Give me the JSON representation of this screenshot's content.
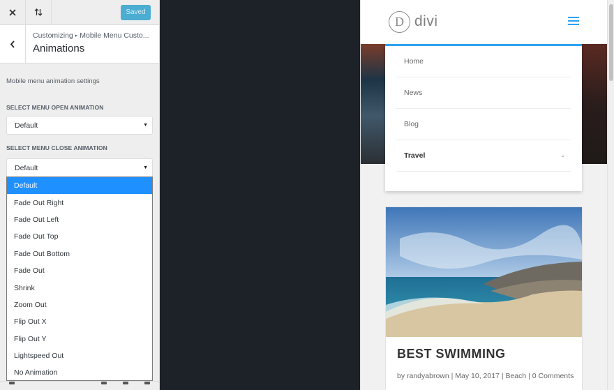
{
  "customizer": {
    "topbar": {
      "saved_label": "Saved"
    },
    "breadcrumb": {
      "root": "Customizing",
      "separator": "▸",
      "section": "Mobile Menu Custo..."
    },
    "section_title": "Animations",
    "description": "Mobile menu animation settings",
    "open_animation": {
      "label": "SELECT MENU OPEN ANIMATION",
      "value": "Default"
    },
    "close_animation": {
      "label": "SELECT MENU CLOSE ANIMATION",
      "value": "Default",
      "options": [
        "Default",
        "Fade Out Right",
        "Fade Out Left",
        "Fade Out Top",
        "Fade Out Bottom",
        "Fade Out",
        "Shrink",
        "Zoom Out",
        "Flip Out X",
        "Flip Out Y",
        "Lightspeed Out",
        "No Animation"
      ],
      "selected_index": 0
    }
  },
  "preview": {
    "logo": {
      "mark": "D",
      "text": "divi"
    },
    "menu_items": [
      {
        "label": "Home"
      },
      {
        "label": "News"
      },
      {
        "label": "Blog"
      },
      {
        "label": "Travel",
        "has_children": true
      }
    ],
    "post": {
      "title": "BEST SWIMMING",
      "meta": "by randyabrown | May 10, 2017 | Beach | 0 Comments"
    }
  },
  "colors": {
    "accent": "#2ea3f2",
    "saved_button": "#2ea2cc",
    "selected_option": "#1e90ff"
  },
  "icons": {
    "close": "close-icon",
    "reorder": "sort-arrows-icon",
    "back": "chevron-left-icon",
    "menu": "hamburger-icon"
  }
}
